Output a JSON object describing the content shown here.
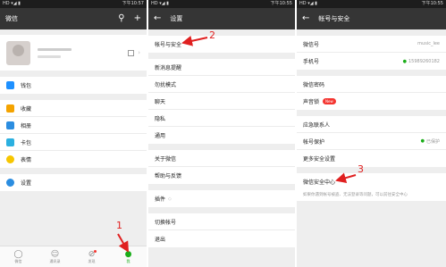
{
  "status": {
    "time": "下午10:57",
    "time2": "下午10:55",
    "signal": "HD ▾◢ ▮"
  },
  "panel1": {
    "title": "微信",
    "profile_blur": "微信号",
    "items": [
      {
        "label": "钱包",
        "color": "#1e90ff"
      },
      {
        "label": "收藏",
        "color": "#f4a300"
      },
      {
        "label": "相册",
        "color": "#2b8de0"
      },
      {
        "label": "卡包",
        "color": "#2bb0e0"
      },
      {
        "label": "表情",
        "color": "#f7c600"
      },
      {
        "label": "设置",
        "color": "#2b8de0"
      }
    ],
    "tabs": [
      "微信",
      "通讯录",
      "发现",
      "我"
    ]
  },
  "panel2": {
    "title": "设置",
    "items": [
      "帐号与安全",
      "新消息提醒",
      "勿扰模式",
      "聊天",
      "隐私",
      "通用",
      "关于微信",
      "帮助与反馈",
      "插件",
      "切换帐号",
      "退出"
    ]
  },
  "panel3": {
    "title": "帐号与安全",
    "wechat_id_label": "微信号",
    "wechat_id_value": "music_lee",
    "phone_label": "手机号",
    "phone_value": "15989260182",
    "password_label": "微信密码",
    "voice_lock_label": "声音锁",
    "new_badge": "New",
    "emergency_label": "应急联系人",
    "protect_label": "帐号保护",
    "protect_value": "已保护",
    "more_label": "更多安全设置",
    "center_label": "微信安全中心",
    "center_desc": "如果你遇到帐号被盗、无法登录等问题，可以前往安全中心"
  },
  "annotations": {
    "n1": "1",
    "n2": "2",
    "n3": "3",
    "color": "#e02020"
  }
}
